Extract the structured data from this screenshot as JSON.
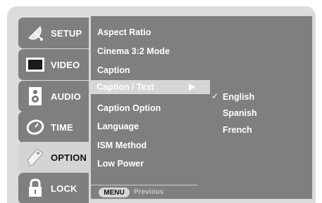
{
  "sidebar": {
    "items": [
      {
        "label": "SETUP",
        "icon": "satellite-dish-icon"
      },
      {
        "label": "VIDEO",
        "icon": "tv-screen-icon"
      },
      {
        "label": "AUDIO",
        "icon": "speaker-icon"
      },
      {
        "label": "TIME",
        "icon": "clock-icon"
      },
      {
        "label": "OPTION",
        "icon": "tag-icon",
        "selected": true
      },
      {
        "label": "LOCK",
        "icon": "padlock-icon"
      }
    ]
  },
  "submenu": {
    "items": [
      {
        "label": "Aspect Ratio"
      },
      {
        "label": "Cinema 3:2 Mode"
      },
      {
        "label": "Caption"
      },
      {
        "label": "Caption / Text",
        "selected": true
      },
      {
        "label": "Caption Option"
      },
      {
        "label": "Language"
      },
      {
        "label": "ISM Method"
      },
      {
        "label": "Low Power"
      }
    ]
  },
  "options": {
    "check_mark": "✓",
    "items": [
      {
        "label": "English",
        "checked": true
      },
      {
        "label": "Spanish"
      },
      {
        "label": "French"
      }
    ]
  },
  "footer": {
    "menu_label": "MENU",
    "previous_label": "Previous"
  },
  "colors": {
    "panel_bg": "#dcdcdc",
    "item_bg": "#7f7f7f",
    "selected_bg": "#d4d4d4",
    "text": "#ffffff"
  }
}
